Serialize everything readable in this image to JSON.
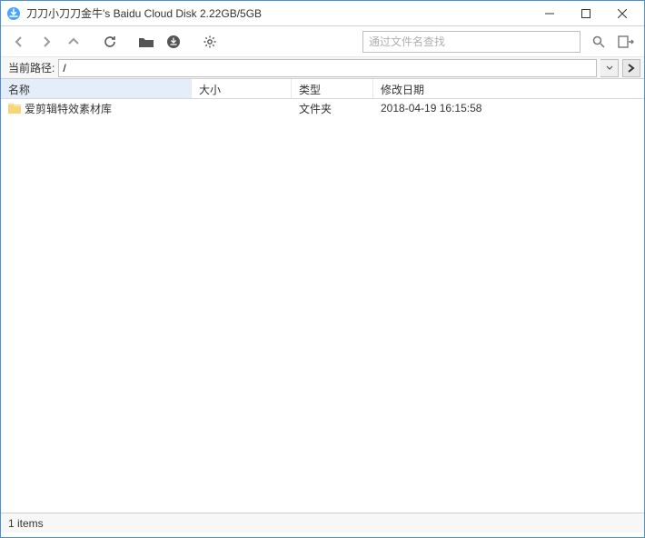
{
  "window": {
    "title": "刀刀小刀刀金牛's Baidu Cloud Disk 2.22GB/5GB"
  },
  "toolbar": {
    "search_placeholder": "通过文件名查找"
  },
  "path": {
    "label": "当前路径:",
    "value": "/"
  },
  "columns": {
    "name": "名称",
    "size": "大小",
    "type": "类型",
    "modified": "修改日期"
  },
  "rows": [
    {
      "name": "爱剪辑特效素材库",
      "size": "",
      "type": "文件夹",
      "modified": "2018-04-19 16:15:58"
    }
  ],
  "status": {
    "text": "1 items"
  }
}
